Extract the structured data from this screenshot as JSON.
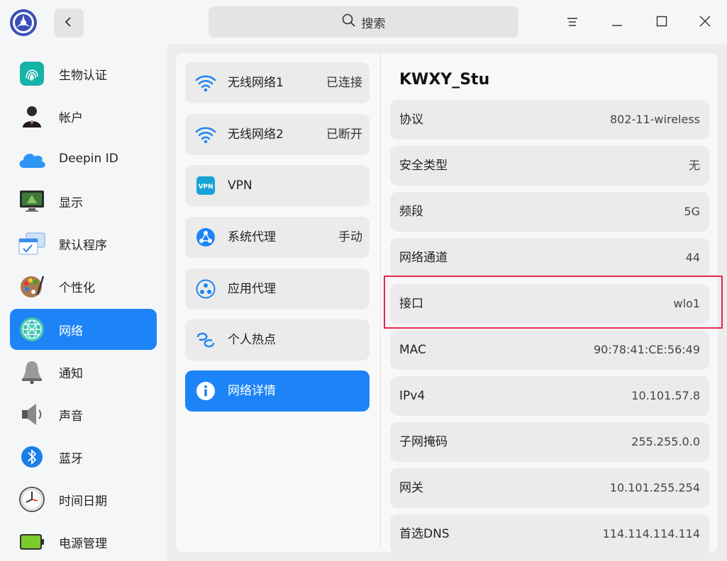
{
  "titlebar": {
    "search_placeholder": "搜索"
  },
  "sidebar": {
    "items": [
      {
        "label": "生物认证",
        "icon": "fingerprint-icon"
      },
      {
        "label": "帐户",
        "icon": "account-icon"
      },
      {
        "label": "Deepin ID",
        "icon": "cloud-icon"
      },
      {
        "label": "显示",
        "icon": "display-icon"
      },
      {
        "label": "默认程序",
        "icon": "default-apps-icon"
      },
      {
        "label": "个性化",
        "icon": "palette-icon"
      },
      {
        "label": "网络",
        "icon": "network-globe-icon",
        "active": true
      },
      {
        "label": "通知",
        "icon": "bell-icon"
      },
      {
        "label": "声音",
        "icon": "speaker-icon"
      },
      {
        "label": "蓝牙",
        "icon": "bluetooth-icon"
      },
      {
        "label": "时间日期",
        "icon": "clock-icon"
      },
      {
        "label": "电源管理",
        "icon": "battery-icon"
      }
    ]
  },
  "network_list": {
    "items": [
      {
        "label": "无线网络1",
        "status": "已连接",
        "icon": "wifi-icon"
      },
      {
        "label": "无线网络2",
        "status": "已断开",
        "icon": "wifi-icon"
      },
      {
        "label": "VPN",
        "status": "",
        "icon": "vpn-icon"
      },
      {
        "label": "系统代理",
        "status": "手动",
        "icon": "system-proxy-icon"
      },
      {
        "label": "应用代理",
        "status": "",
        "icon": "app-proxy-icon"
      },
      {
        "label": "个人热点",
        "status": "",
        "icon": "hotspot-icon"
      },
      {
        "label": "网络详情",
        "status": "",
        "icon": "info-icon",
        "active": true
      }
    ]
  },
  "details": {
    "title": "KWXY_Stu",
    "rows": [
      {
        "key": "协议",
        "value": "802-11-wireless"
      },
      {
        "key": "安全类型",
        "value": "无"
      },
      {
        "key": "频段",
        "value": "5G"
      },
      {
        "key": "网络通道",
        "value": "44"
      },
      {
        "key": "接口",
        "value": "wlo1"
      },
      {
        "key": "MAC",
        "value": "90:78:41:CE:56:49"
      },
      {
        "key": "IPv4",
        "value": "10.101.57.8"
      },
      {
        "key": "子网掩码",
        "value": "255.255.0.0"
      },
      {
        "key": "网关",
        "value": "10.101.255.254"
      },
      {
        "key": "首选DNS",
        "value": "114.114.114.114"
      }
    ]
  },
  "colors": {
    "accent": "#1c84f7",
    "highlight": "#e5294f"
  }
}
